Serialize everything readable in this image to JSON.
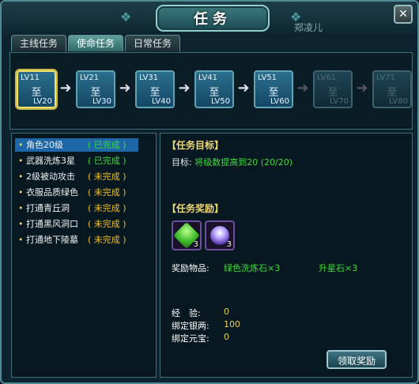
{
  "window": {
    "title": "任务",
    "behind_text": "郑凌儿"
  },
  "tabs": [
    {
      "label": "主线任务",
      "active": false
    },
    {
      "label": "使命任务",
      "active": true
    },
    {
      "label": "日常任务",
      "active": false
    }
  ],
  "levels": [
    {
      "from": "LV11",
      "mid": "至",
      "to": "LV20",
      "state": "active"
    },
    {
      "from": "LV21",
      "mid": "至",
      "to": "LV30",
      "state": "open"
    },
    {
      "from": "LV31",
      "mid": "至",
      "to": "LV40",
      "state": "open"
    },
    {
      "from": "LV41",
      "mid": "至",
      "to": "LV50",
      "state": "open"
    },
    {
      "from": "LV51",
      "mid": "至",
      "to": "LV60",
      "state": "open"
    },
    {
      "from": "LV61",
      "mid": "至",
      "to": "LV70",
      "state": "locked"
    },
    {
      "from": "LV71",
      "mid": "至",
      "to": "LV80",
      "state": "locked"
    }
  ],
  "quests": [
    {
      "name": "角色20级",
      "status": "( 已完成 )",
      "done": true,
      "selected": true
    },
    {
      "name": "武器洗炼3星",
      "status": "( 已完成 )",
      "done": true,
      "selected": false
    },
    {
      "name": "2级被动攻击",
      "status": "( 未完成 )",
      "done": false,
      "selected": false
    },
    {
      "name": "衣服品质绿色",
      "status": "( 未完成 )",
      "done": false,
      "selected": false
    },
    {
      "name": "打通青丘洞",
      "status": "( 未完成 )",
      "done": false,
      "selected": false
    },
    {
      "name": "打通黑风洞口",
      "status": "( 未完成 )",
      "done": false,
      "selected": false
    },
    {
      "name": "打通地下陵墓",
      "status": "( 未完成 )",
      "done": false,
      "selected": false
    }
  ],
  "detail": {
    "target_header": "【任务目标】",
    "target_label": "目标:",
    "target_value": "将级数提高到20 (20/20)",
    "reward_header": "【任务奖励】",
    "reward_items": [
      {
        "name": "绿色洗炼石",
        "count": "3",
        "icon": "green-gem-icon",
        "color": "#5ee04a"
      },
      {
        "name": "升星石",
        "count": "3",
        "icon": "purple-star-stone-icon",
        "color": "#9a7ef0"
      }
    ],
    "reward_label": "奖励物品:",
    "reward_item1_text": "绿色洗炼石×3",
    "reward_item2_text": "升星石×3",
    "exp_label": "经　验:",
    "exp_value": "0",
    "silver_label": "绑定银两:",
    "silver_value": "100",
    "yuanbao_label": "绑定元宝:",
    "yuanbao_value": "0",
    "claim_button": "领取奖励"
  }
}
